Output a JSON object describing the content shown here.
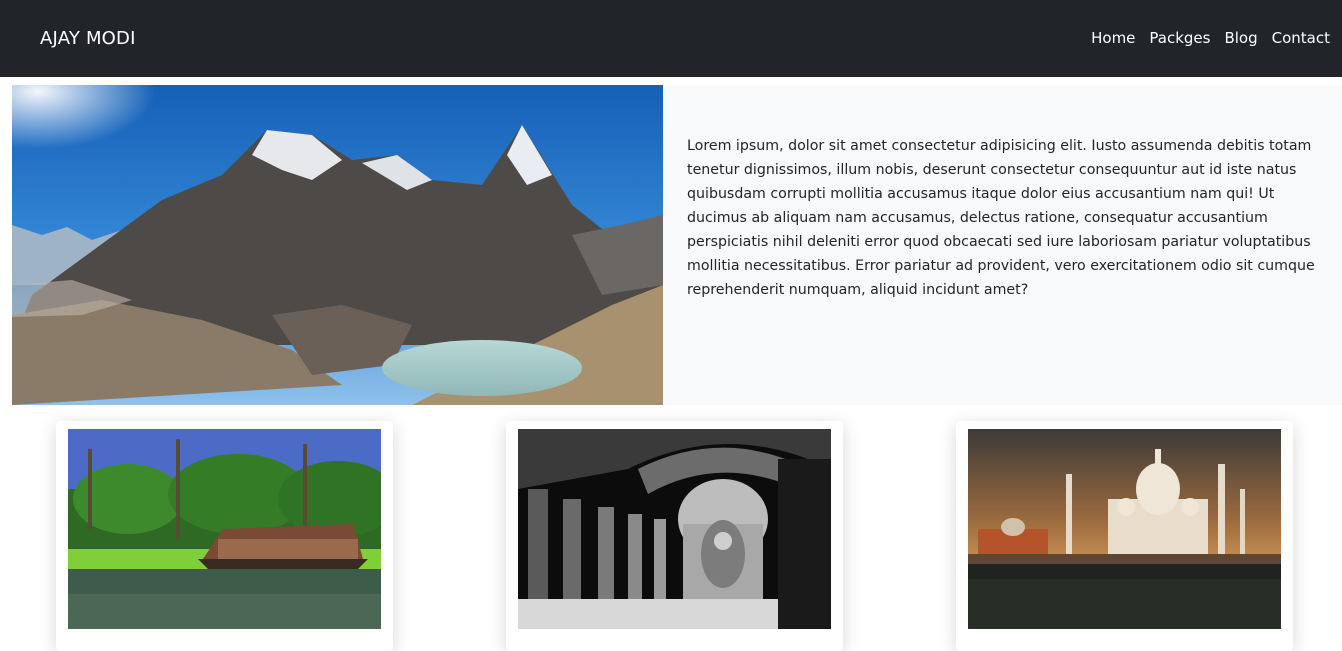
{
  "navbar": {
    "brand": "AJAY MODI",
    "links": [
      "Home",
      "Packges",
      "Blog",
      "Contact"
    ],
    "background": "#212529"
  },
  "hero": {
    "image": "mountain-lake-image",
    "text": "Lorem ipsum, dolor sit amet consectetur adipisicing elit. Iusto assumenda debitis totam tenetur dignissimos, illum nobis, deserunt consectetur consequuntur aut id iste natus quibusdam corrupti mollitia accusamus itaque dolor eius accusantium nam qui! Ut ducimus ab aliquam nam accusamus, delectus ratione, consequatur accusantium perspiciatis nihil deleniti error quod obcaecati sed iure laboriosam pariatur voluptatibus mollitia necessitatibus. Error pariatur ad provident, vero exercitationem odio sit cumque reprehenderit numquam, aliquid incidunt amet?"
  },
  "cards": [
    {
      "image": "kerala-houseboat-image"
    },
    {
      "image": "cave-temple-buddha-image"
    },
    {
      "image": "taj-mahal-image"
    }
  ]
}
